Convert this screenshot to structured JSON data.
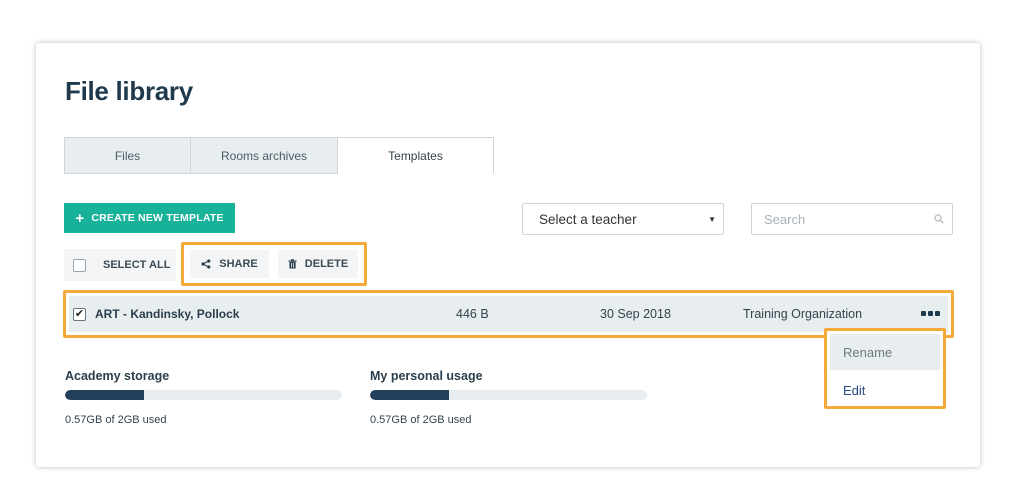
{
  "page": {
    "title": "File library"
  },
  "tabs": [
    {
      "label": "Files",
      "active": false
    },
    {
      "label": "Rooms archives",
      "active": false
    },
    {
      "label": "Templates",
      "active": true
    }
  ],
  "toolbar": {
    "create_label": "CREATE NEW TEMPLATE",
    "teacher_select": "Select a teacher",
    "search_placeholder": "Search",
    "select_all_label": "SELECT ALL",
    "share_label": "SHARE",
    "delete_label": "DELETE"
  },
  "files": [
    {
      "name": "ART - Kandinsky, Pollock",
      "size": "446 B",
      "date": "30 Sep 2018",
      "organization": "Training Organization",
      "checked": true
    }
  ],
  "context_menu": {
    "items": [
      {
        "label": "Rename"
      },
      {
        "label": "Edit"
      }
    ]
  },
  "storage": {
    "academy": {
      "label": "Academy storage",
      "used_text": "0.57GB of 2GB used",
      "fraction": 0.285
    },
    "personal": {
      "label": "My personal usage",
      "used_text": "0.57GB of 2GB used",
      "fraction": 0.285
    }
  },
  "colors": {
    "accent": "#18b29a",
    "highlight": "#f5a93b",
    "bar_fill": "#23405a",
    "title": "#1f3a4d"
  }
}
